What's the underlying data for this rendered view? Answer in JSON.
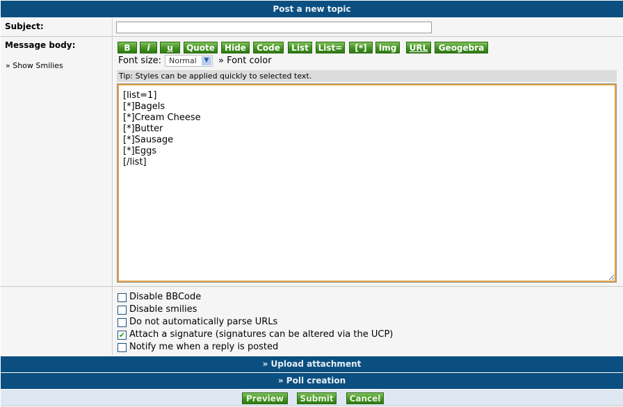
{
  "header": {
    "title": "Post a new topic"
  },
  "subject": {
    "label": "Subject:",
    "value": ""
  },
  "message": {
    "label": "Message body:",
    "show_smilies": "» Show Smilies"
  },
  "toolbar": {
    "buttons": [
      "B",
      "i",
      "u",
      "Quote",
      "Hide",
      "Code",
      "List",
      "List=",
      "[*]",
      "Img",
      "URL",
      "Geogebra"
    ],
    "font_size_label": "Font size:",
    "font_size_value": "Normal",
    "font_color": "» Font color",
    "tip": "Tip: Styles can be applied quickly to selected text."
  },
  "body_text": "[list=1]\n[*]Bagels\n[*]Cream Cheese\n[*]Butter\n[*]Sausage\n[*]Eggs\n[/list]",
  "options": [
    {
      "label": "Disable BBCode",
      "checked": false
    },
    {
      "label": "Disable smilies",
      "checked": false
    },
    {
      "label": "Do not automatically parse URLs",
      "checked": false
    },
    {
      "label": "Attach a signature (signatures can be altered via the UCP)",
      "checked": true
    },
    {
      "label": "Notify me when a reply is posted",
      "checked": false
    }
  ],
  "sections": {
    "upload": "» Upload attachment",
    "poll": "» Poll creation"
  },
  "actions": {
    "preview": "Preview",
    "submit": "Submit",
    "cancel": "Cancel"
  },
  "colors": {
    "header_bg": "#0b4f80",
    "button_green": "#3f8f1f",
    "focus_border": "#e0a040"
  }
}
